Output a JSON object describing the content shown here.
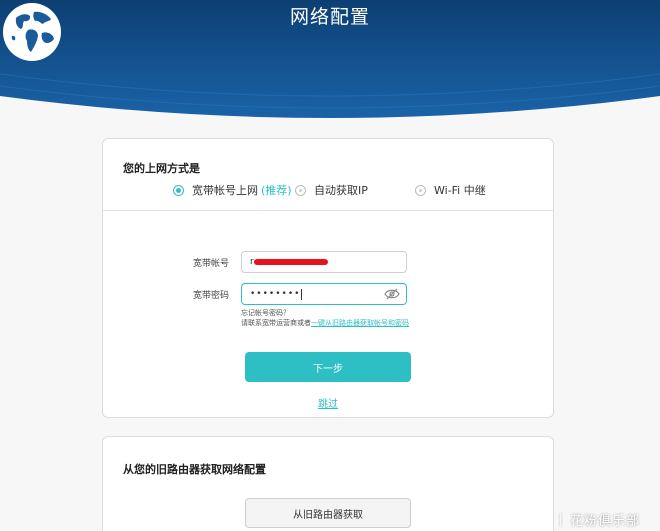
{
  "header": {
    "title": "网络配置",
    "globe_icon": "globe-icon",
    "color_dark": "#0d3f73",
    "color_mid": "#1a63a8"
  },
  "connection_card": {
    "title": "您的上网方式是",
    "options": [
      {
        "label": "宽带帐号上网",
        "badge": "(推荐)",
        "selected": true
      },
      {
        "label": "自动获取IP",
        "badge": "",
        "selected": false
      },
      {
        "label": "Wi-Fi 中继",
        "badge": "",
        "selected": false
      }
    ],
    "account_label": "宽带帐号",
    "account_value": "r",
    "password_label": "宽带密码",
    "password_value": "••••••••",
    "eye_icon": "eye-icon",
    "forgot_line1": "忘记帐号密码？",
    "forgot_line2": "请联系宽带运营商或者",
    "forgot_link": "一键从旧路由器获取帐号和密码",
    "next_button": "下一步",
    "skip_link": "跳过"
  },
  "old_router_card": {
    "title": "从您的旧路由器获取网络配置",
    "button": "从旧路由器获取"
  },
  "watermark": {
    "separator": "|",
    "text": "花粉俱乐部",
    "icon": "huawei-logo-icon"
  },
  "colors": {
    "accent": "#2dbfc4",
    "redaction": "#e8121b"
  }
}
